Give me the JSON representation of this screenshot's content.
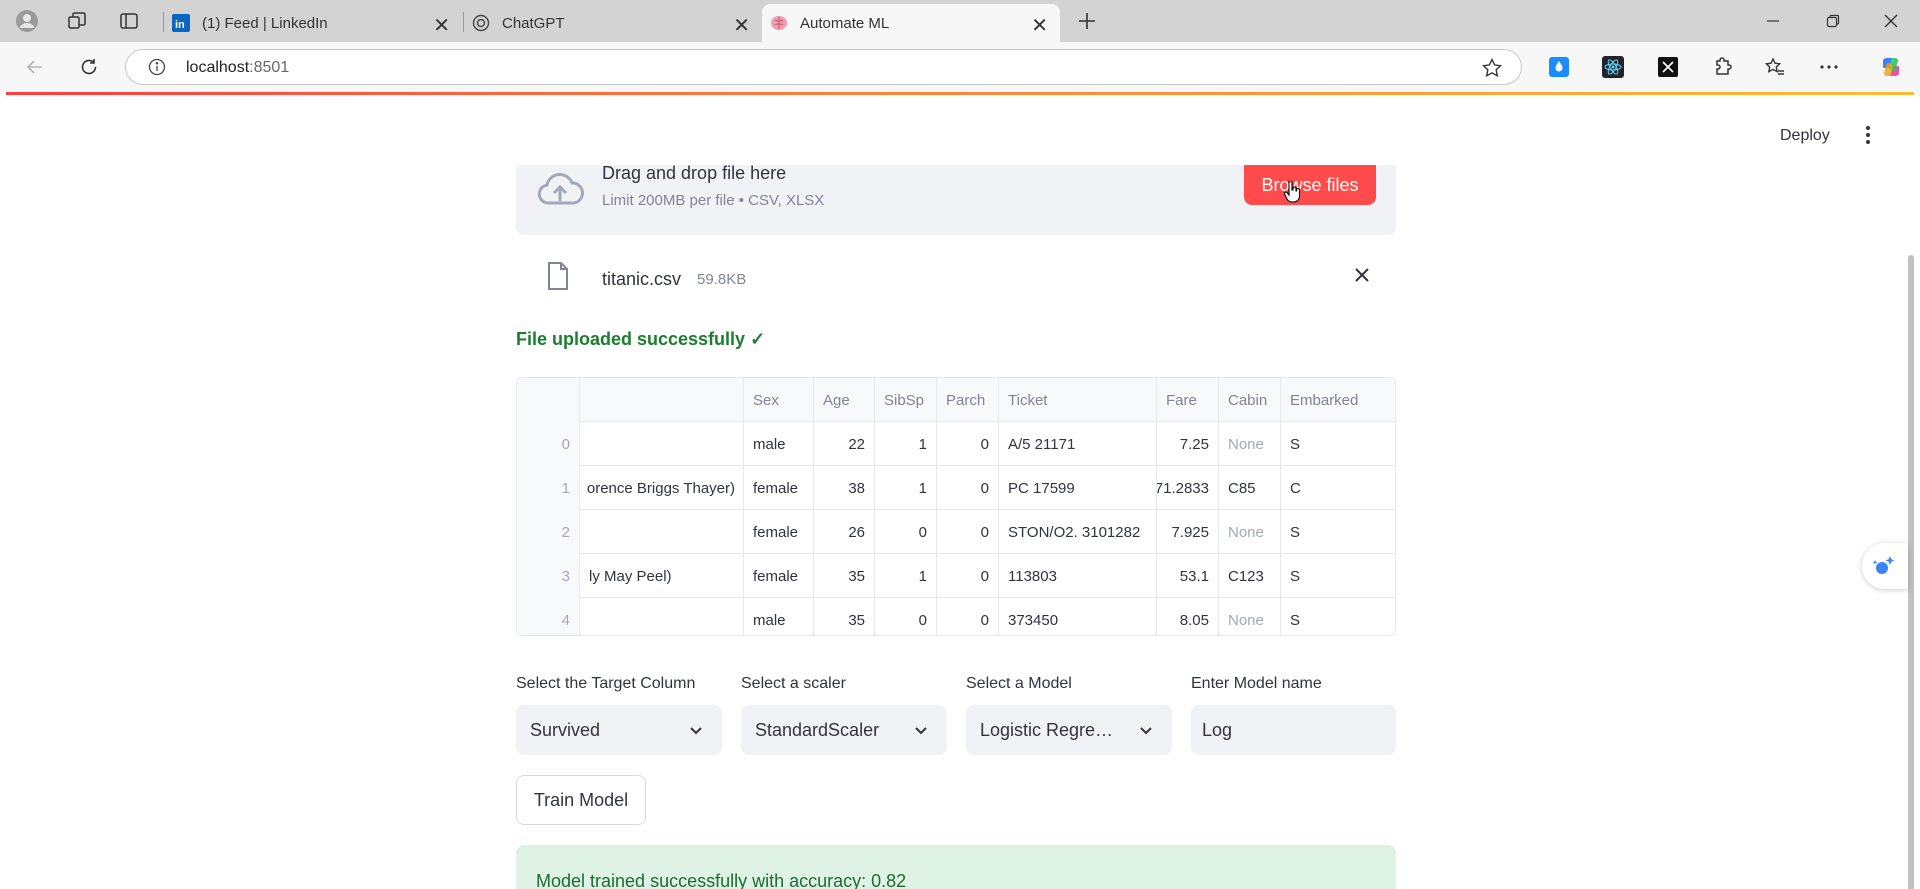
{
  "browser": {
    "tabs": [
      {
        "title": "(1) Feed | LinkedIn"
      },
      {
        "title": "ChatGPT"
      },
      {
        "title": "Automate ML"
      }
    ],
    "url_host": "localhost",
    "url_port": ":8501"
  },
  "header": {
    "deploy_label": "Deploy"
  },
  "uploader": {
    "title": "Drag and drop file here",
    "subtitle": "Limit 200MB per file • CSV, XLSX",
    "browse_label": "Browse files",
    "file_name": "titanic.csv",
    "file_size": "59.8KB"
  },
  "status": {
    "upload_success": "File uploaded successfully ✓"
  },
  "table": {
    "columns": [
      "",
      "",
      "Sex",
      "Age",
      "SibSp",
      "Parch",
      "Ticket",
      "Fare",
      "Cabin",
      "Embarked"
    ],
    "rows": [
      [
        "0",
        "",
        "male",
        "22",
        "1",
        "0",
        "A/5 21171",
        "7.25",
        "None",
        "S"
      ],
      [
        "1",
        "orence Briggs Thayer)",
        "female",
        "38",
        "1",
        "0",
        "PC 17599",
        "71.2833",
        "C85",
        "C"
      ],
      [
        "2",
        "",
        "female",
        "26",
        "0",
        "0",
        "STON/O2. 3101282",
        "7.925",
        "None",
        "S"
      ],
      [
        "3",
        "ly May Peel)",
        "female",
        "35",
        "1",
        "0",
        "113803",
        "53.1",
        "C123",
        "S"
      ],
      [
        "4",
        "",
        "male",
        "35",
        "0",
        "0",
        "373450",
        "8.05",
        "None",
        "S"
      ]
    ]
  },
  "form": {
    "target_label": "Select the Target Column",
    "target_value": "Survived",
    "scaler_label": "Select a scaler",
    "scaler_value": "StandardScaler",
    "model_label": "Select a Model",
    "model_value": "Logistic Regre…",
    "name_label": "Enter Model name",
    "name_value": "Log",
    "train_label": "Train Model"
  },
  "result": {
    "message": "Model trained successfully with accuracy: 0.82"
  },
  "colors": {
    "accent": "#ff4b4b",
    "success_text": "#1a7f2e",
    "success_bg": "#dff3e4"
  }
}
